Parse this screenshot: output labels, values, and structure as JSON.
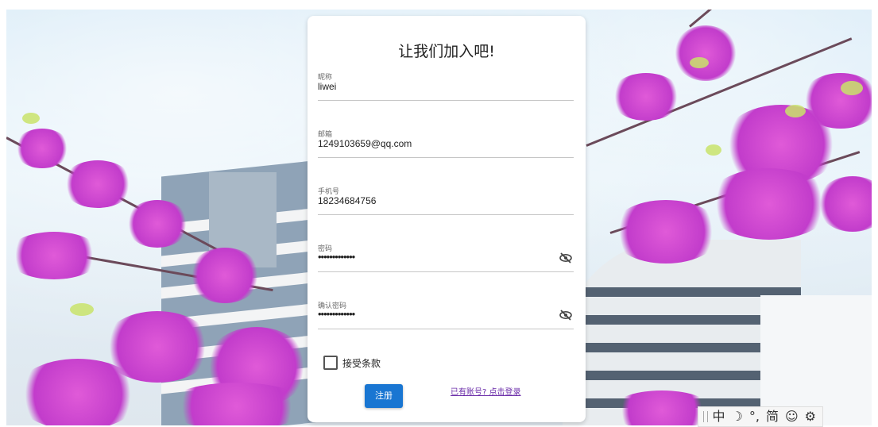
{
  "form": {
    "title": "让我们加入吧!",
    "fields": [
      {
        "label": "昵称",
        "value": "liwei"
      },
      {
        "label": "邮箱",
        "value": "1249103659@qq.com"
      },
      {
        "label": "手机号",
        "value": "18234684756"
      },
      {
        "label": "密码",
        "value": "•••••••••••••"
      },
      {
        "label": "确认密码",
        "value": "•••••••••••••"
      }
    ],
    "agree_label": "接受条款",
    "agree_checked": false,
    "submit_label": "注册",
    "login_link": "已有账号? 点击登录",
    "accent": "#1976d2",
    "link_color": "#6a2ba8"
  },
  "ime_toolbar": {
    "items": [
      "中",
      "☽",
      "°,",
      "简",
      "☺",
      "⚙"
    ]
  }
}
